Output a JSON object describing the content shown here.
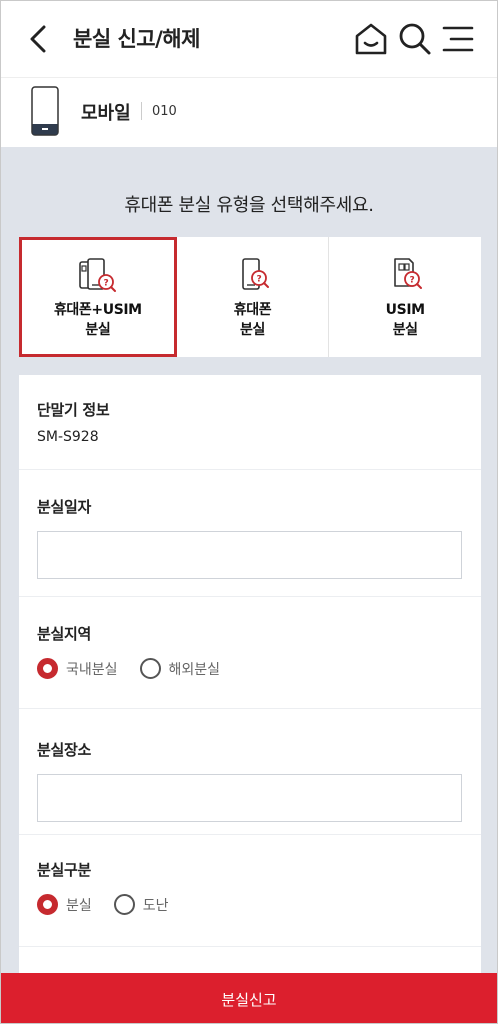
{
  "header": {
    "title": "분실 신고/해제",
    "back_icon": "chevron-left-icon",
    "home_icon": "home-icon",
    "search_icon": "search-icon",
    "menu_icon": "menu-icon"
  },
  "device": {
    "name": "모바일",
    "number": "010"
  },
  "prompt": "휴대폰 분실 유형을 선택해주세요.",
  "loss_types": [
    {
      "line1": "휴대폰+USIM",
      "line2": "분실",
      "selected": true
    },
    {
      "line1": "휴대폰",
      "line2": "분실",
      "selected": false
    },
    {
      "line1": "USIM",
      "line2": "분실",
      "selected": false
    }
  ],
  "form": {
    "device_info_label": "단말기 정보",
    "device_model": "SM-S928",
    "loss_date_label": "분실일자",
    "loss_date_value": "",
    "loss_region_label": "분실지역",
    "region_options": [
      "국내분실",
      "해외분실"
    ],
    "region_selected": "국내분실",
    "loss_place_label": "분실장소",
    "loss_place_value": "",
    "loss_category_label": "분실구분",
    "category_options": [
      "분실",
      "도난"
    ],
    "category_selected": "분실"
  },
  "submit_label": "분실신고",
  "colors": {
    "accent": "#c62a2f",
    "submit": "#dc1f2d",
    "background": "#dfe3ea"
  }
}
